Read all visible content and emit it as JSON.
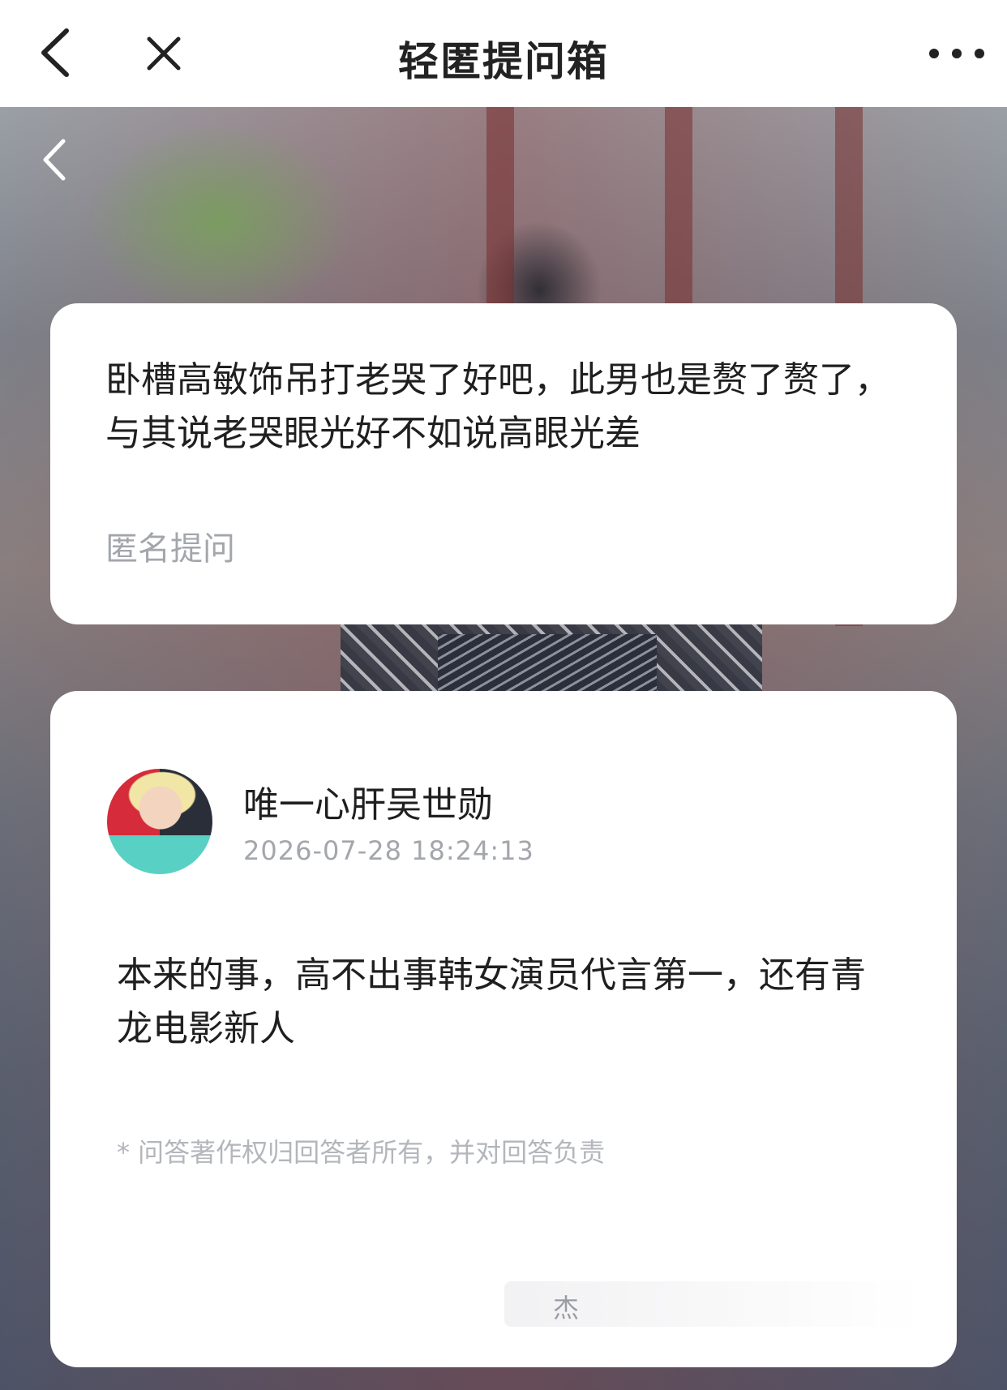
{
  "nav": {
    "title": "轻匿提问箱",
    "back_icon": "chevron-left-icon",
    "close_icon": "close-icon",
    "more_icon": "more-horizontal-icon"
  },
  "hero": {
    "back_icon": "chevron-left-icon"
  },
  "question": {
    "text": "卧槽高敏饰吊打老哭了好吧，此男也是赘了赘了，与其说老哭眼光好不如说高眼光差",
    "author_label": "匿名提问"
  },
  "answer": {
    "username": "唯一心肝吴世勋",
    "timestamp": "2026-07-28 18:24:13",
    "text": "本来的事，高不出事韩女演员代言第一，还有青龙电影新人",
    "copyright_notice": "* 问答著作权归回答者所有，并对回答负责",
    "input_fragment": "杰"
  },
  "colors": {
    "card_bg": "#ffffff",
    "muted_text": "#a3a6ab",
    "primary_text": "#1f1f1f"
  }
}
